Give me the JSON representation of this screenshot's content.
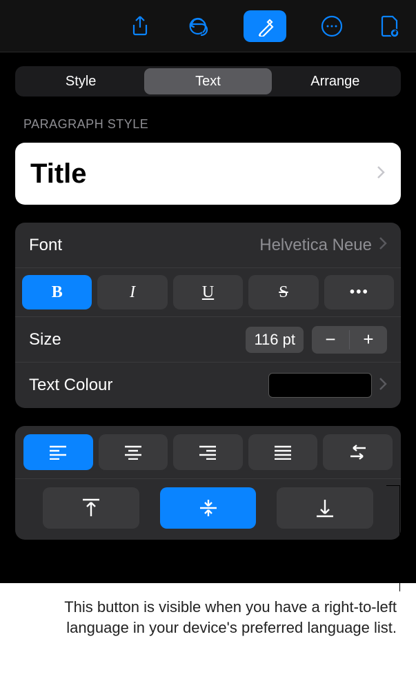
{
  "tabs": {
    "style": "Style",
    "text": "Text",
    "arrange": "Arrange"
  },
  "paragraph": {
    "section_label": "PARAGRAPH STYLE",
    "value": "Title"
  },
  "font": {
    "label": "Font",
    "value": "Helvetica Neue"
  },
  "styles": {
    "bold": "B",
    "italic": "I",
    "underline": "U",
    "strike": "S",
    "more": "•••"
  },
  "size": {
    "label": "Size",
    "value": "116 pt",
    "minus": "−",
    "plus": "+"
  },
  "colour": {
    "label": "Text Colour",
    "swatch": "#000000"
  },
  "caption": "This button is visible when you have a right-to-left language in your device's preferred language list."
}
